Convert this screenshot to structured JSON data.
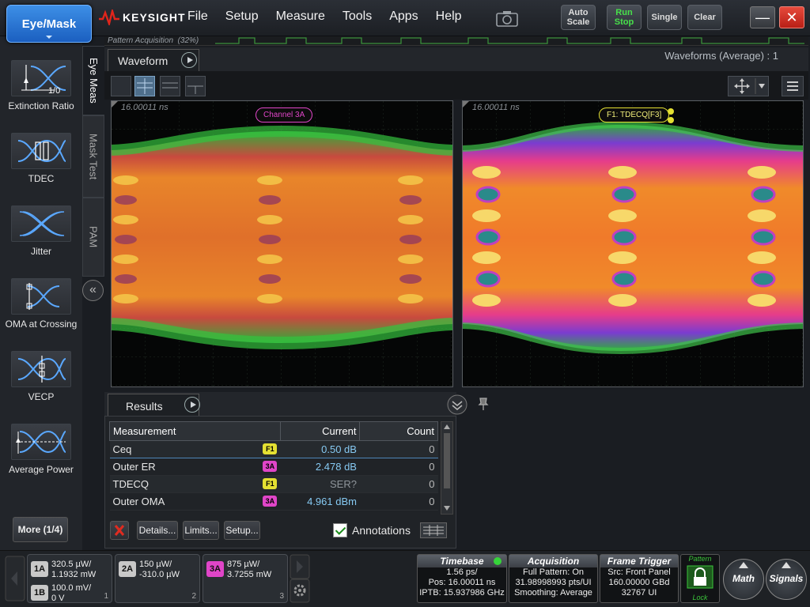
{
  "topbar": {
    "eye_mask_label": "Eye/Mask",
    "brand": "KEYSIGHT",
    "menu": [
      "File",
      "Setup",
      "Measure",
      "Tools",
      "Apps",
      "Help"
    ],
    "auto_scale": "Auto Scale",
    "run_stop": "Run Stop",
    "single": "Single",
    "clear": "Clear",
    "minimize": "—",
    "close": "✕"
  },
  "pattern": {
    "label": "Pattern Acquisition",
    "percent": "(32%)"
  },
  "sidebar": {
    "items": [
      {
        "label": "Extinction Ratio",
        "icon": "extinction-ratio-icon",
        "sub": "1/0"
      },
      {
        "label": "TDEC",
        "icon": "tdec-icon"
      },
      {
        "label": "Jitter",
        "icon": "jitter-icon"
      },
      {
        "label": "OMA at Crossing",
        "icon": "oma-crossing-icon"
      },
      {
        "label": "VECP",
        "icon": "vecp-icon"
      },
      {
        "label": "Average Power",
        "icon": "average-power-icon"
      }
    ],
    "more": "More (1/4)"
  },
  "vtabs": {
    "eye_meas": "Eye Meas",
    "mask_test": "Mask Test",
    "pam": "PAM"
  },
  "waveform": {
    "tab": "Waveform",
    "status": "Waveforms (Average) : 1",
    "left_time": "16.00011 ns",
    "right_time": "16.00011 ns",
    "left_channel": "Channel 3A",
    "right_channel": "F1: TDECQ[F3]"
  },
  "results": {
    "tab": "Results",
    "headers": {
      "measurement": "Measurement",
      "current": "Current",
      "count": "Count"
    },
    "rows": [
      {
        "name": "Ceq",
        "src": "F1",
        "src_type": "f1",
        "current": "0.50 dB",
        "count": "0"
      },
      {
        "name": "Outer ER",
        "src": "3A",
        "src_type": "c3",
        "current": "2.478 dB",
        "count": "0"
      },
      {
        "name": "TDECQ",
        "src": "F1",
        "src_type": "f1",
        "current": "SER?",
        "count": "0"
      },
      {
        "name": "Outer OMA",
        "src": "3A",
        "src_type": "c3",
        "current": "4.961 dBm",
        "count": "0"
      }
    ],
    "details": "Details...",
    "limits": "Limits...",
    "setup": "Setup...",
    "annotations": "Annotations"
  },
  "channels": {
    "c1a": {
      "label": "1A",
      "v1": "320.5 µW/",
      "v2": "1.1932 mW"
    },
    "c1b": {
      "label": "1B",
      "v1": "100.0 mV/",
      "v2": "0 V"
    },
    "c2a": {
      "label": "2A",
      "v1": "150 µW/",
      "v2": "-310.0 µW"
    },
    "c3a": {
      "label": "3A",
      "v1": "875 µW/",
      "v2": "3.7255 mW"
    },
    "num1": "1",
    "num2": "2",
    "num3": "3"
  },
  "timebase": {
    "title": "Timebase",
    "l1": "1.56 ps/",
    "l2": "Pos: 16.00011 ns",
    "l3": "IPTB: 15.937986 GHz"
  },
  "acquisition": {
    "title": "Acquisition",
    "l1": "Full Pattern: On",
    "l2": "31.98998993 pts/UI",
    "l3": "Smoothing: Average"
  },
  "trigger": {
    "title": "Frame Trigger",
    "l1": "Src: Front Panel",
    "l2": "160.00000 GBd",
    "l3": "32767 UI"
  },
  "lock": {
    "top": "Pattern",
    "bottom": "Lock"
  },
  "math": "Math",
  "signals": "Signals",
  "colors": {
    "accent": "#1b5fc0",
    "f1": "#e4e032",
    "ch3": "#e045c8",
    "ch1": "#c8c8c8"
  }
}
